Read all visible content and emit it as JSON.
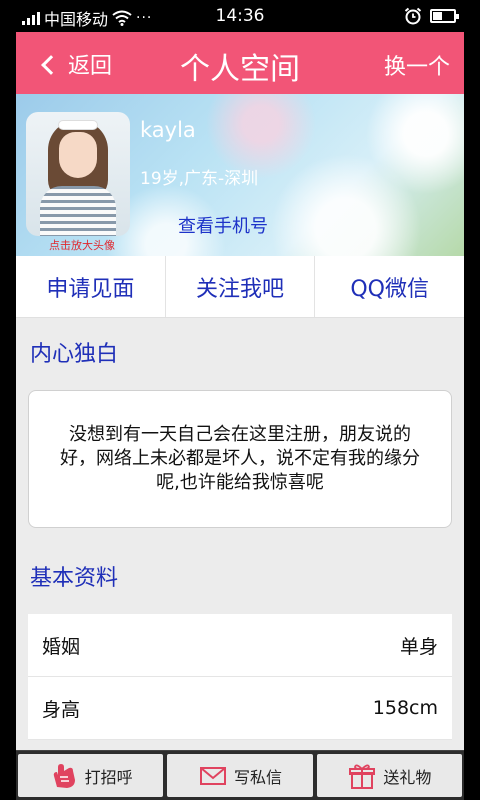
{
  "status_bar": {
    "carrier": "中国移动",
    "time": "14:36",
    "signal_icon": "signal-bars-icon",
    "wifi_icon": "wifi-icon",
    "more_icon": "more-dots-icon",
    "alarm_icon": "alarm-clock-icon",
    "battery_icon": "battery-icon",
    "battery_level": 0.45
  },
  "header": {
    "back_label": "返回",
    "title": "个人空间",
    "switch_label": "换一个",
    "background_color": "#f25577"
  },
  "profile": {
    "nickname": "kayla",
    "age_location": "19岁,广东-深圳",
    "view_phone_label": "查看手机号",
    "enlarge_avatar_label": "点击放大头像"
  },
  "actions": [
    {
      "label": "申请见面"
    },
    {
      "label": "关注我吧"
    },
    {
      "label": "QQ微信"
    }
  ],
  "monologue": {
    "title": "内心独白",
    "text": "没想到有一天自己会在这里注册，朋友说的好，网络上未必都是坏人，说不定有我的缘分呢,也许能给我惊喜呢"
  },
  "basic_info": {
    "title": "基本资料",
    "rows": [
      {
        "label": "婚姻",
        "value": "单身"
      },
      {
        "label": "身高",
        "value": "158cm"
      }
    ]
  },
  "toolbar": [
    {
      "label": "打招呼",
      "icon": "wave-hand-icon"
    },
    {
      "label": "写私信",
      "icon": "envelope-icon"
    },
    {
      "label": "送礼物",
      "icon": "gift-icon"
    }
  ],
  "colors": {
    "accent": "#f25577",
    "link": "#1f2fb8",
    "warning_text": "#e0282e",
    "toolbar_bg": "#2d2d2d"
  }
}
